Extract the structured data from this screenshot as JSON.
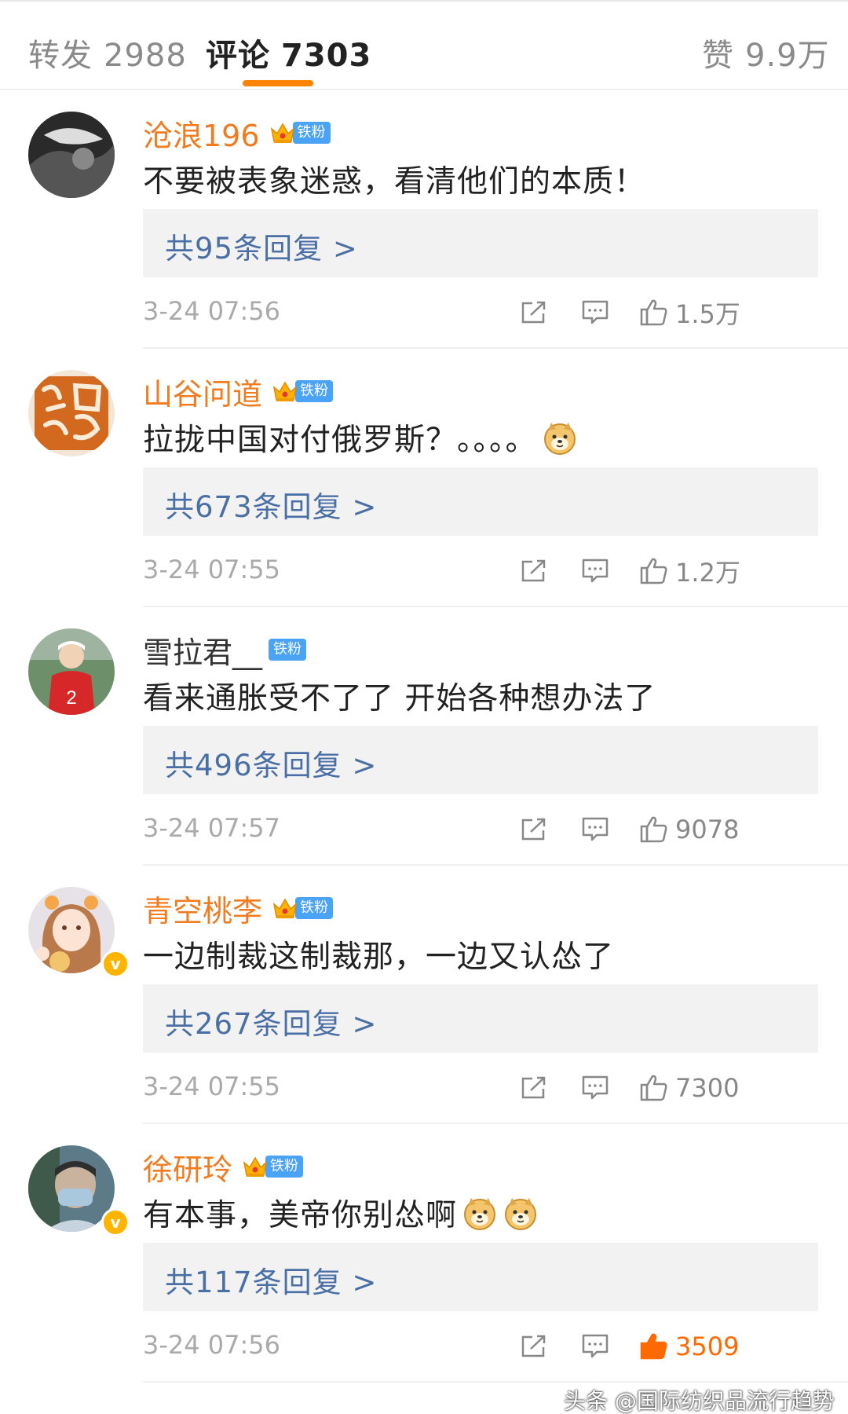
{
  "tabs": {
    "repost": {
      "label": "转发",
      "count": "2988"
    },
    "comment": {
      "label": "评论",
      "count": "7303"
    },
    "like": {
      "label": "赞",
      "count": "9.9万"
    }
  },
  "colors": {
    "accent": "#ff8200",
    "username": "#f07c1f",
    "reply_link": "#4a6fa5",
    "fan_badge": "#4aa3f5",
    "liked": "#ff6a00"
  },
  "badge_label": "铁粉",
  "comments": [
    {
      "username": "沧浪196",
      "crown": true,
      "verified": false,
      "text": "不要被表象迷惑，看清他们的本质！",
      "emoji_count": 0,
      "replies": "共95条回复 >",
      "time": "3-24 07:56",
      "likes": "1.5万",
      "liked": false,
      "avatar": "dark-photo"
    },
    {
      "username": "山谷问道",
      "crown": true,
      "verified": false,
      "text": "拉拢中国对付俄罗斯？。。。。",
      "emoji_count": 1,
      "replies": "共673条回复 >",
      "time": "3-24 07:55",
      "likes": "1.2万",
      "liked": false,
      "avatar": "calligraphy-seal"
    },
    {
      "username": "雪拉君__",
      "crown": false,
      "verified": false,
      "text": "看来通胀受不了了 开始各种想办法了",
      "emoji_count": 0,
      "replies": "共496条回复 >",
      "time": "3-24 07:57",
      "likes": "9078",
      "liked": false,
      "avatar": "jersey-player"
    },
    {
      "username": "青空桃李",
      "crown": true,
      "verified": true,
      "text": "一边制裁这制裁那，一边又认怂了",
      "emoji_count": 0,
      "replies": "共267条回复 >",
      "time": "3-24 07:55",
      "likes": "7300",
      "liked": false,
      "avatar": "anime-girl"
    },
    {
      "username": "徐研玲",
      "crown": true,
      "verified": true,
      "text": "有本事，美帝你别怂啊",
      "emoji_count": 2,
      "replies": "共117条回复 >",
      "time": "3-24 07:56",
      "likes": "3509",
      "liked": true,
      "avatar": "masked-person"
    }
  ],
  "watermark": "头条 @国际纺织品流行趋势"
}
